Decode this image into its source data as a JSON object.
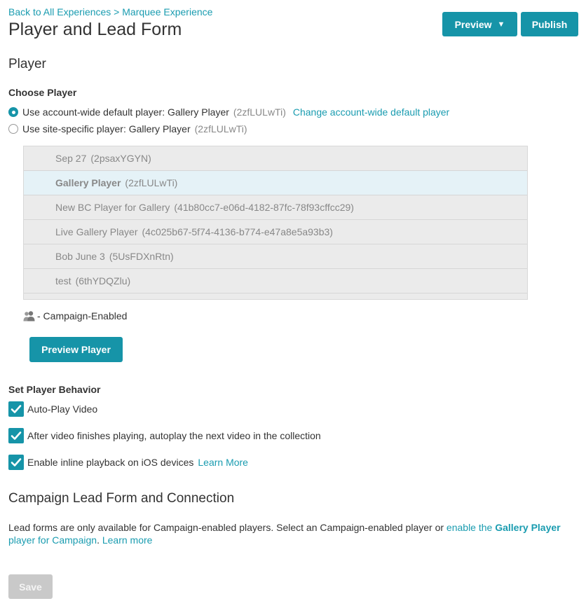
{
  "header": {
    "breadcrumb": "Back to All Experiences > Marquee Experience",
    "title": "Player and Lead Form",
    "preview_label": "Preview",
    "preview_caret": "▼",
    "publish_label": "Publish"
  },
  "player_section": {
    "title": "Player",
    "choose_label": "Choose Player",
    "options": [
      {
        "label": "Use account-wide default player: Gallery Player",
        "id": "(2zfLULwTi)",
        "link": "Change account-wide default player",
        "checked": true
      },
      {
        "label": "Use site-specific player: Gallery Player",
        "id": "(2zfLULwTi)",
        "checked": false
      }
    ],
    "players": [
      {
        "name": "Sep 27",
        "id": "(2psaxYGYN)"
      },
      {
        "name": "Gallery Player",
        "id": "(2zfLULwTi)",
        "selected": true
      },
      {
        "name": "New BC Player for Gallery",
        "id": "(41b80cc7-e06d-4182-87fc-78f93cffcc29)"
      },
      {
        "name": "Live Gallery Player",
        "id": "(4c025b67-5f74-4136-b774-e47a8e5a93b3)"
      },
      {
        "name": "Bob June 3",
        "id": "(5UsFDXnRtn)"
      },
      {
        "name": "test",
        "id": "(6thYDQZlu)"
      }
    ],
    "legend_icon": "users-icon",
    "legend_text": "- Campaign-Enabled",
    "preview_player_label": "Preview Player"
  },
  "behavior": {
    "title": "Set Player Behavior",
    "options": [
      {
        "label": "Auto-Play Video",
        "checked": true
      },
      {
        "label": "After video finishes playing, autoplay the next video in the collection",
        "checked": true
      },
      {
        "label": "Enable inline playback on iOS devices",
        "checked": true,
        "link": "Learn More"
      }
    ]
  },
  "campaign": {
    "title": "Campaign Lead Form and Connection",
    "desc_text": "Lead forms are only available for Campaign-enabled players. Select an Campaign-enabled player or ",
    "desc_link_pre": "enable the ",
    "desc_link_bold": "Gallery Player",
    "desc_link_post": " player for Campaign",
    "desc_period": ". ",
    "learn_more": "Learn more"
  },
  "footer": {
    "save_label": "Save"
  },
  "colors": {
    "accent": "#1694a8",
    "link": "#1a9cb0",
    "selected_row": "#e5f2f7",
    "disabled": "#c9c9c9"
  }
}
